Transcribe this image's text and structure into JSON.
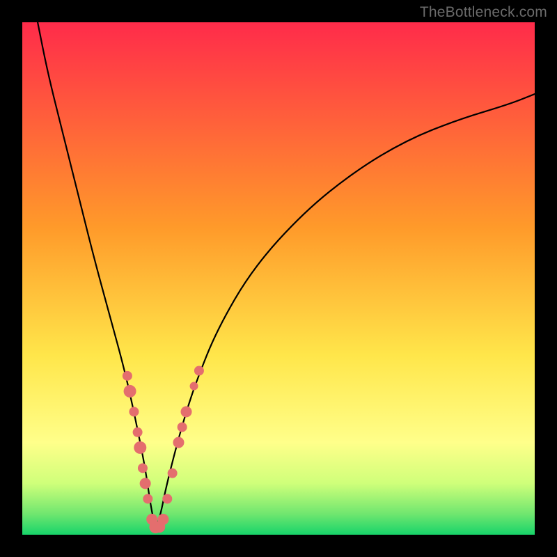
{
  "watermark": "TheBottleneck.com",
  "chart_data": {
    "type": "line",
    "title": "",
    "xlabel": "",
    "ylabel": "",
    "xlim": [
      0,
      100
    ],
    "ylim": [
      0,
      100
    ],
    "grid": false,
    "legend": false,
    "background_gradient": {
      "stops": [
        {
          "offset": 0.0,
          "color": "#ff2b4a"
        },
        {
          "offset": 0.4,
          "color": "#ff9a2a"
        },
        {
          "offset": 0.65,
          "color": "#ffe64a"
        },
        {
          "offset": 0.82,
          "color": "#ffff8a"
        },
        {
          "offset": 0.9,
          "color": "#cfff7a"
        },
        {
          "offset": 0.96,
          "color": "#6fe66f"
        },
        {
          "offset": 1.0,
          "color": "#17d46a"
        }
      ]
    },
    "series": [
      {
        "name": "bottleneck-curve",
        "note": "V-shaped curve; trough near x≈26, y≈1. y roughly represents bottleneck % (higher=worse).",
        "x": [
          3,
          5,
          8,
          11,
          14,
          17,
          20,
          22,
          24,
          25,
          26,
          27,
          28,
          30,
          32,
          34,
          38,
          45,
          55,
          65,
          75,
          85,
          95,
          100
        ],
        "y": [
          100,
          90,
          78,
          66,
          54,
          43,
          32,
          23,
          13,
          6,
          1,
          4,
          9,
          17,
          24,
          30,
          40,
          52,
          63,
          71,
          77,
          81,
          84,
          86
        ]
      }
    ],
    "markers": {
      "name": "highlighted-points",
      "note": "Salmon-colored dots clustered around the trough on both arms of the V.",
      "color": "#e46e6e",
      "radius_range": [
        5,
        10
      ],
      "points": [
        {
          "x": 20.5,
          "y": 31,
          "r": 7
        },
        {
          "x": 21.0,
          "y": 28,
          "r": 9
        },
        {
          "x": 21.8,
          "y": 24,
          "r": 7
        },
        {
          "x": 22.5,
          "y": 20,
          "r": 7
        },
        {
          "x": 23.0,
          "y": 17,
          "r": 9
        },
        {
          "x": 23.5,
          "y": 13,
          "r": 7
        },
        {
          "x": 24.0,
          "y": 10,
          "r": 8
        },
        {
          "x": 24.5,
          "y": 7,
          "r": 7
        },
        {
          "x": 25.3,
          "y": 3,
          "r": 8
        },
        {
          "x": 26.0,
          "y": 1.5,
          "r": 9
        },
        {
          "x": 26.8,
          "y": 1.5,
          "r": 8
        },
        {
          "x": 27.5,
          "y": 3,
          "r": 8
        },
        {
          "x": 28.3,
          "y": 7,
          "r": 7
        },
        {
          "x": 29.3,
          "y": 12,
          "r": 7
        },
        {
          "x": 30.5,
          "y": 18,
          "r": 8
        },
        {
          "x": 31.2,
          "y": 21,
          "r": 7
        },
        {
          "x": 32.0,
          "y": 24,
          "r": 8
        },
        {
          "x": 33.5,
          "y": 29,
          "r": 6
        },
        {
          "x": 34.5,
          "y": 32,
          "r": 7
        }
      ]
    }
  }
}
